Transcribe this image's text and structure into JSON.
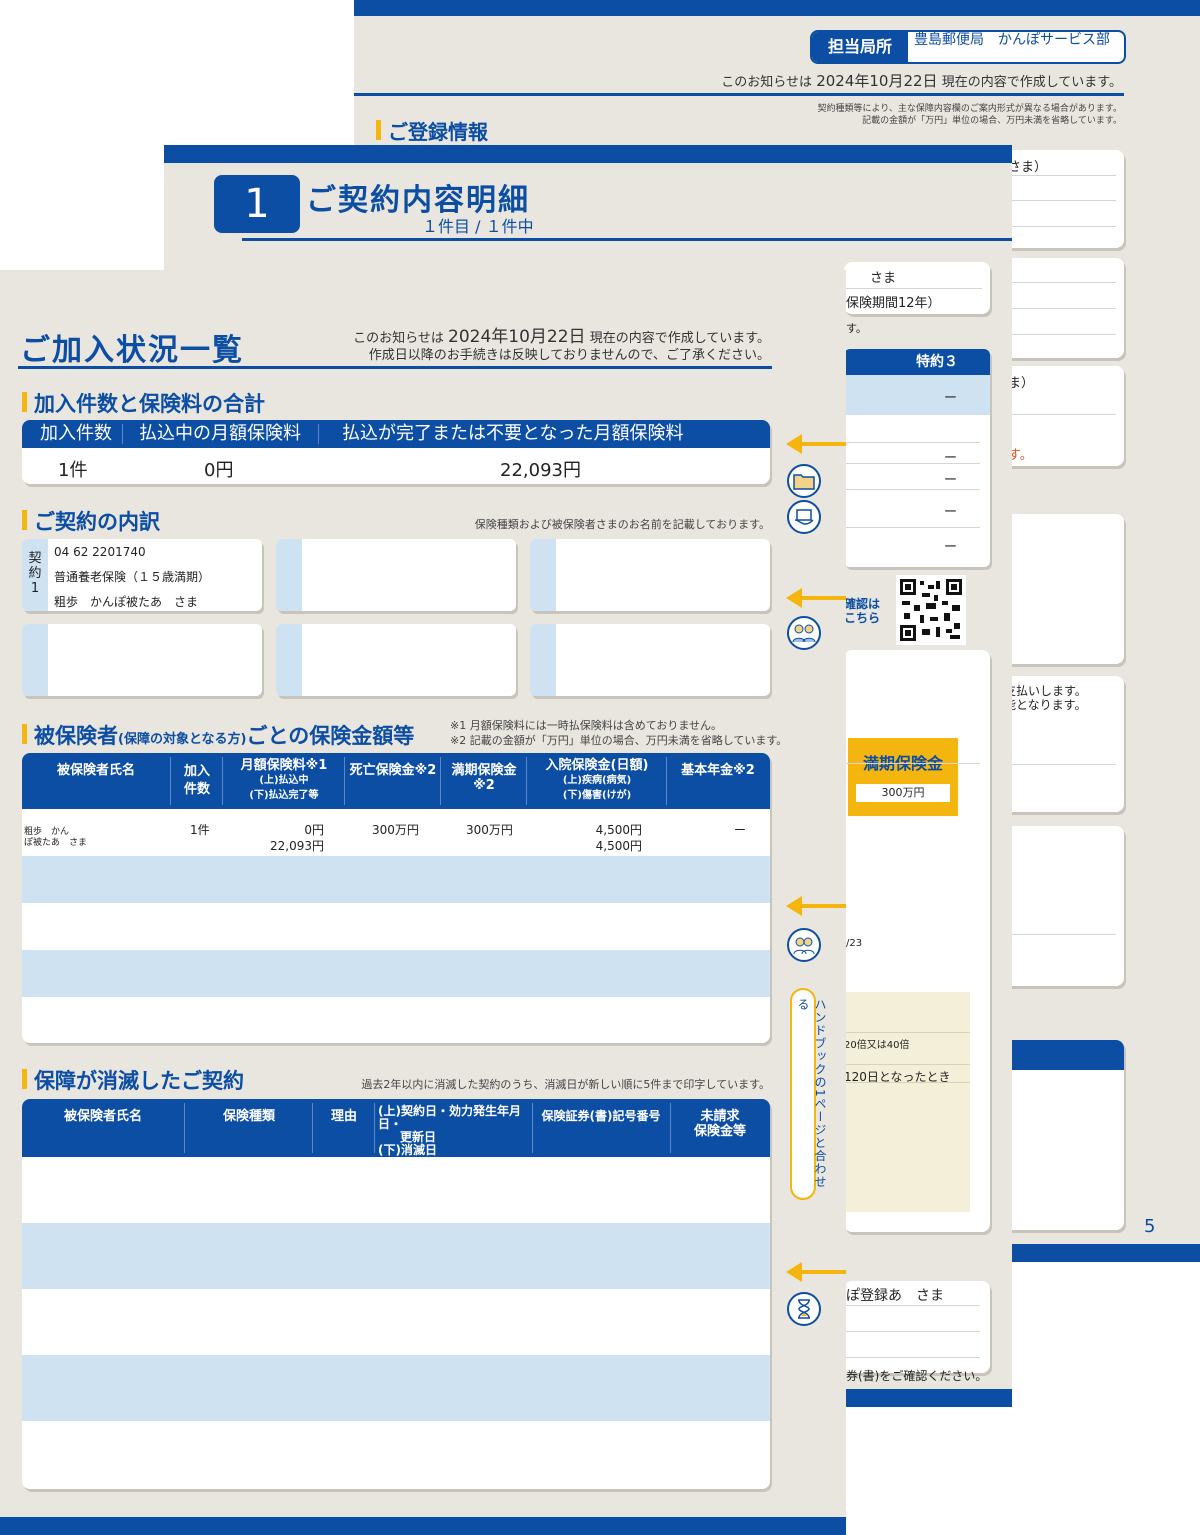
{
  "back": {
    "office_label": "担当局所",
    "office_name": "豊島郵便局　かんぽサービス部",
    "notice_prefix": "このお知らせは",
    "notice_date": "2024年10月22日",
    "notice_suffix": "現在の内容で作成しています。",
    "note1": "契約種類等により、主な保障内容欄のご案内形式が異なる場合があります。",
    "note2": "記載の金額が「万円」単位の場合、万円未満を省略しています。",
    "section": "ご登録情報",
    "frag_sama1": "さま）",
    "frag_sama2": "ま）",
    "frag_red": "す。",
    "frag_pay1": "支払いします。",
    "frag_pay2": "能となります。",
    "page_number": "5"
  },
  "middle": {
    "number": "1",
    "title": "ご契約内容明細",
    "subtitle": "１件目 / １件中",
    "frag_name": "さま",
    "frag_period": "保険期間12年）",
    "frag_su": "す。",
    "tokuyaku3": "特約３",
    "dashes": [
      "ー",
      "ー",
      "ー",
      "ー",
      "ー"
    ],
    "qr_caption1": "確認は",
    "qr_caption2": "こちら",
    "maturity_label": "満期保険金",
    "maturity_value": "300万円",
    "frag_23": "/23",
    "frag_multiple": "20倍又は40倍",
    "frag_120": "120日となったとき",
    "frag_toroku": "ぽ登録あ　さま",
    "frag_confirm": "券(書)をご確認ください。"
  },
  "front": {
    "title": "ご加入状況一覧",
    "notice_prefix": "このお知らせは",
    "notice_date": "2024年10月22日",
    "notice_suffix": "現在の内容で作成しています。",
    "notice_line2": "作成日以降のお手続きは反映しておりませんので、ご了承ください。",
    "summary": {
      "heading": "加入件数と保険料の合計",
      "headers": [
        "加入件数",
        "払込中の月額保険料",
        "払込が完了または不要となった月額保険料"
      ],
      "values": [
        "1件",
        "0円",
        "22,093円"
      ]
    },
    "breakdown": {
      "heading": "ご契約の内訳",
      "note": "保険種類および被保険者さまのお名前を記載しております。",
      "card1": {
        "tab": "契約1",
        "number": "04 62 2201740",
        "type": "普通養老保険（１５歳満期）",
        "name": "粗歩　かんぽ被たあ　さま"
      }
    },
    "insured": {
      "heading_main": "被保険者",
      "heading_paren": "(保障の対象となる方)",
      "heading_tail": "ごとの保険金額等",
      "note1": "※1 月額保険料には一時払保険料は含めておりません。",
      "note2": "※2 記載の金額が「万円」単位の場合、万円未満を省略しています。",
      "headers": {
        "name": "被保険者氏名",
        "count": "加入件数",
        "premium": "月額保険料※1",
        "premium_sub1": "(上)払込中",
        "premium_sub2": "(下)払込完了等",
        "death": "死亡保険金※2",
        "maturity": "満期保険金※2",
        "hosp": "入院保険金(日額)",
        "hosp_sub1": "(上)疾病(病気)",
        "hosp_sub2": "(下)傷害(けが)",
        "pension": "基本年金※2"
      },
      "row": {
        "name1": "粗歩　かん",
        "name2": "ぽ被たあ　さま",
        "count": "1件",
        "premium_top": "0円",
        "premium_bottom": "22,093円",
        "death": "300万円",
        "maturity": "300万円",
        "hosp_top": "4,500円",
        "hosp_bottom": "4,500円",
        "pension": "ー"
      }
    },
    "lapsed": {
      "heading": "保障が消滅したご契約",
      "note": "過去2年以内に消滅した契約のうち、消滅日が新しい順に5件まで印字しています。",
      "headers": {
        "name": "被保険者氏名",
        "type": "保険種類",
        "reason": "理由",
        "dates_a": "(上)",
        "dates_b": "契約日・効力発生年月日・",
        "dates_c": "更新日",
        "dates_d": "(下)消滅日",
        "number": "保険証券(書)記号番号",
        "unclaimed1": "未請求",
        "unclaimed2": "保険金等"
      }
    },
    "handbook_label": "ハンドブックの1ページと合わせる"
  },
  "colors": {
    "primary": "#0c4ea3",
    "accent": "#f5b50f",
    "light_row": "#cfe2f2",
    "paper": "#e9e6df"
  }
}
